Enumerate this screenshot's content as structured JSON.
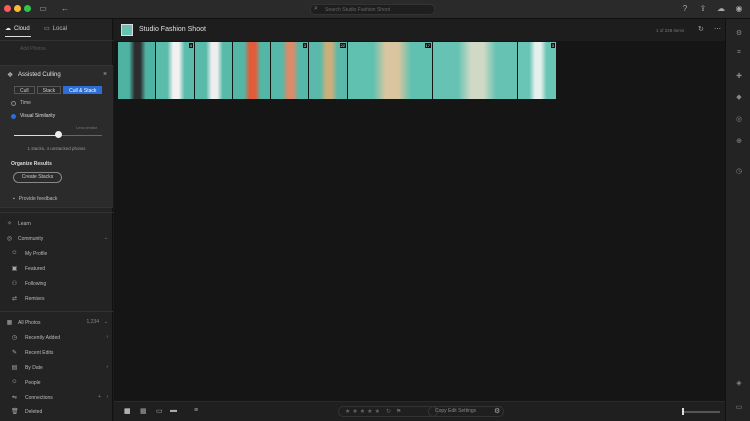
{
  "titlebar": {
    "traffic_colors": [
      "#fd5b58",
      "#fdbb2f",
      "#2ac94b"
    ],
    "search_placeholder": "Search Studio Fashion Shoot",
    "icons": [
      "sidebar-toggle-icon",
      "back-icon",
      "help-icon",
      "share-icon",
      "cloud-sync-icon",
      "account-icon"
    ]
  },
  "left_panel": {
    "tabs": [
      {
        "label": "Cloud",
        "icon": "cloud-icon",
        "active": true
      },
      {
        "label": "Local",
        "icon": "folder-icon",
        "active": false
      }
    ],
    "add_photos": "Add Photos",
    "assisted_culling": {
      "title": "Assisted Culling",
      "segments": [
        {
          "label": "Cull",
          "selected": false
        },
        {
          "label": "Stack",
          "selected": false
        },
        {
          "label": "Cull & Stack",
          "selected": true
        }
      ],
      "option_time": "Time",
      "option_visual": "Visual Similarity",
      "slider_label": "Less similar",
      "slider_value": 0.5,
      "stacks_text": "1 stacks, 4 unstacked photos",
      "organize_title": "Organize Results",
      "create_button": "Create Stacks",
      "feedback": "Provide feedback"
    },
    "learn": "Learn",
    "community": {
      "title": "Community",
      "items": [
        "My Profile",
        "Featured",
        "Following",
        "Remixes"
      ]
    },
    "library": {
      "title": "All Photos",
      "count": "1,234",
      "items": [
        "Recently Added",
        "Recent Edits",
        "By Date",
        "People",
        "Connections",
        "Deleted"
      ]
    }
  },
  "main": {
    "album_title": "Studio Fashion Shoot",
    "item_count": "1 of 228 items",
    "photos": [
      {
        "width": 37,
        "badge": "",
        "colors": [
          "#4fb3a3",
          "#2d2d2d"
        ],
        "selected": false
      },
      {
        "width": 38,
        "badge": "4",
        "colors": [
          "#5bbcac",
          "#f1f1f1"
        ],
        "selected": true
      },
      {
        "width": 37,
        "badge": "",
        "colors": [
          "#58baa9",
          "#eeeeee"
        ],
        "selected": false
      },
      {
        "width": 37,
        "badge": "",
        "colors": [
          "#54b7a6",
          "#e25b3a"
        ],
        "selected": false
      },
      {
        "width": 37,
        "badge": "3",
        "colors": [
          "#56b8a8",
          "#d98b6a"
        ],
        "selected": false
      },
      {
        "width": 38,
        "badge": "22",
        "colors": [
          "#5ab9aa",
          "#c9b07a"
        ],
        "selected": false
      },
      {
        "width": 84,
        "badge": "17",
        "colors": [
          "#61c1b0",
          "#d9c6a1"
        ],
        "selected": false
      },
      {
        "width": 84,
        "badge": "",
        "colors": [
          "#66c3b3",
          "#cfd9c6"
        ],
        "selected": false
      },
      {
        "width": 38,
        "badge": "3",
        "colors": [
          "#6ac5b6",
          "#e3f0ec"
        ],
        "selected": false
      }
    ]
  },
  "bottombar": {
    "view_icons": [
      "grid-view-icon",
      "square-grid-icon",
      "detail-view-icon",
      "single-view-icon"
    ],
    "sort_icon": "sort-icon",
    "stars": [
      "★",
      "★",
      "★",
      "★",
      "★"
    ],
    "copy_edit_settings": "Copy Edit Settings"
  }
}
